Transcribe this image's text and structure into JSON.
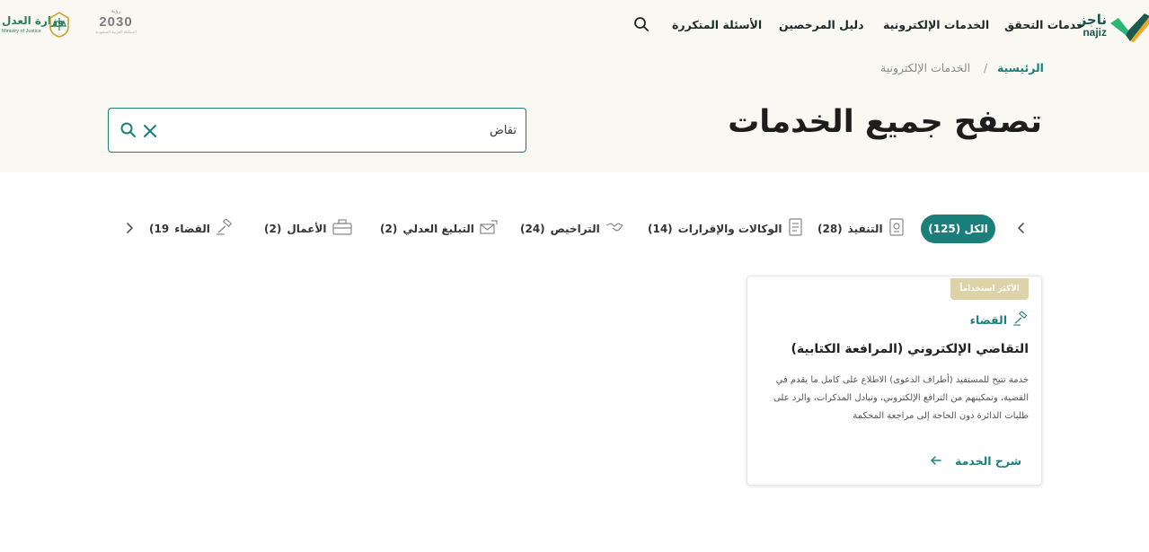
{
  "header": {
    "najiz_logo": {
      "ar": "ناجز",
      "en": "najiz",
      "icon": "najiz-check-logo"
    },
    "nav": [
      {
        "label": "خدمات التحقق"
      },
      {
        "label": "الخدمات الإلكترونية"
      },
      {
        "label": "دليل المرخصين"
      },
      {
        "label": "الأسئلة المتكررة"
      }
    ],
    "search_icon": "search-icon",
    "vision_logo": {
      "line1": "رؤية",
      "line2": "2030",
      "line3": "المملكة العربية السعودية"
    },
    "moj_logo": {
      "ar": "وزارة العدل",
      "en": "Ministry of Justice",
      "icon": "moj-emblem"
    }
  },
  "breadcrumb": {
    "home": "الرئيسية",
    "separator": "/",
    "current": "الخدمات الإلكترونية"
  },
  "page_title": "تصفح جميع الخدمات",
  "search": {
    "value": "تقاض",
    "placeholder": ""
  },
  "tabs": [
    {
      "label": "الكل (125)",
      "active": true
    },
    {
      "label": "التنفيذ",
      "count": "(28)",
      "icon": "execution-icon"
    },
    {
      "label": "الوكالات والإقرارات",
      "count": "(14)",
      "icon": "document-icon"
    },
    {
      "label": "التراخيص",
      "count": "(24)",
      "icon": "handshake-icon"
    },
    {
      "label": "التبليغ العدلي",
      "count": "(2)",
      "icon": "notification-icon"
    },
    {
      "label": "الأعمال",
      "count": "(2)",
      "icon": "briefcase-icon"
    },
    {
      "label": "القضاء",
      "count": "(19",
      "icon": "gavel-icon"
    }
  ],
  "card": {
    "badge": "الأكثر استخداماً",
    "category": "القضاء",
    "title": "التقاضي الإلكتروني (المرافعة الكتابية)",
    "description": "خدمة تتيح للمستفيد (أطراف الدعوى) الاطلاع على كامل ما يقدم في القضية، وتمكينهم من الترافع الإلكتروني، وتبادل المذكرات، والرد على طلبات الدائرة دون الحاجة إلى مراجعة المحكمة",
    "link": "شرح الخدمة"
  },
  "colors": {
    "primary": "#1a7f7a",
    "hero_bg": "#f9f8f3",
    "badge": "#dcd3a8",
    "logo_green": "#2bb673"
  }
}
